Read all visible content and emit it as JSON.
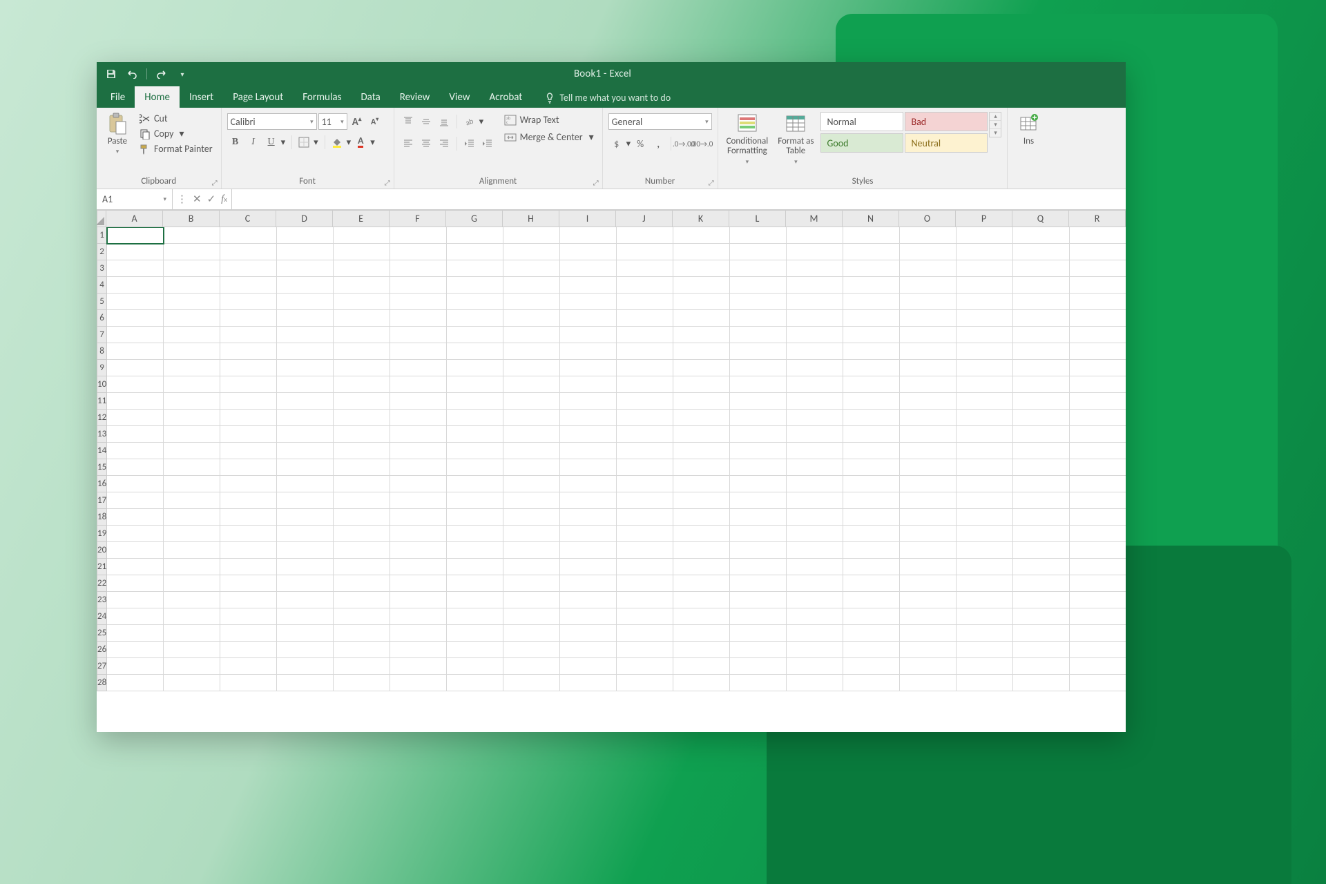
{
  "titlebar": {
    "title": "Book1 - Excel"
  },
  "qat": {
    "save": "save",
    "undo": "undo",
    "redo": "redo"
  },
  "tabs": [
    "File",
    "Home",
    "Insert",
    "Page Layout",
    "Formulas",
    "Data",
    "Review",
    "View",
    "Acrobat"
  ],
  "active_tab": "Home",
  "tellme": "Tell me what you want to do",
  "ribbon": {
    "clipboard": {
      "label": "Clipboard",
      "paste": "Paste",
      "cut": "Cut",
      "copy": "Copy",
      "format_painter": "Format Painter"
    },
    "font": {
      "label": "Font",
      "name": "Calibri",
      "size": "11"
    },
    "alignment": {
      "label": "Alignment",
      "wrap": "Wrap Text",
      "merge": "Merge & Center"
    },
    "number": {
      "label": "Number",
      "format": "General"
    },
    "styles": {
      "label": "Styles",
      "conditional": "Conditional\nFormatting",
      "format_table": "Format as\nTable",
      "normal": "Normal",
      "bad": "Bad",
      "good": "Good",
      "neutral": "Neutral"
    },
    "cells": {
      "insert": "Ins"
    }
  },
  "fbar": {
    "name": "A1",
    "formula": ""
  },
  "columns": [
    "A",
    "B",
    "C",
    "D",
    "E",
    "F",
    "G",
    "H",
    "I",
    "J",
    "K",
    "L",
    "M",
    "N",
    "O",
    "P",
    "Q",
    "R"
  ],
  "rows": [
    "1",
    "2",
    "3",
    "4",
    "5",
    "6",
    "7",
    "8",
    "9",
    "10",
    "11",
    "12",
    "13",
    "14",
    "15",
    "16",
    "17",
    "18",
    "19",
    "20",
    "21",
    "22",
    "23",
    "24",
    "25",
    "26",
    "27",
    "28"
  ],
  "selected_cell": "A1"
}
